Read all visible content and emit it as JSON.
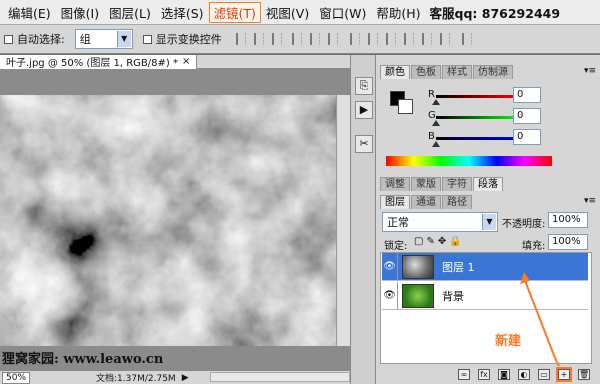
{
  "menubar": {
    "items": [
      "编辑(E)",
      "图像(I)",
      "图层(L)",
      "选择(S)",
      "滤镜(T)",
      "视图(V)",
      "窗口(W)",
      "帮助(H)"
    ],
    "service": "客服qq: 876292449"
  },
  "options": {
    "auto_select_label": "自动选择:",
    "auto_select_value": "组",
    "show_transform_label": "显示变换控件"
  },
  "document": {
    "tab_title": "叶子.jpg @ 50% (图层 1, RGB/8#) *",
    "tab_close": "×",
    "watermark": "狸窝家园: www.leawo.cn",
    "zoom": "50%",
    "doc_info": "文档:1.37M/2.75M"
  },
  "color_panel": {
    "tabs": [
      "颜色",
      "色板",
      "样式",
      "仿制源"
    ],
    "channels": [
      {
        "label": "R",
        "value": "0"
      },
      {
        "label": "G",
        "value": "0"
      },
      {
        "label": "B",
        "value": "0"
      }
    ],
    "foreground_color": "#000000",
    "background_color": "#ffffff"
  },
  "adjust_tabs": [
    "调整",
    "蒙版",
    "字符",
    "段落"
  ],
  "layers_panel": {
    "tabs": [
      "图层",
      "通道",
      "路径"
    ],
    "blend_mode": "正常",
    "opacity_label": "不透明度:",
    "opacity": "100%",
    "lock_label": "锁定:",
    "fill_label": "填充:",
    "fill": "100%",
    "layers": [
      {
        "name": "图层 1",
        "selected": true
      },
      {
        "name": "背景",
        "selected": false
      }
    ]
  },
  "annotation": {
    "label": "新建",
    "color": "#ff7a22"
  },
  "colors": {
    "accent": "#3a76d6",
    "highlight": "#ff7a22"
  }
}
